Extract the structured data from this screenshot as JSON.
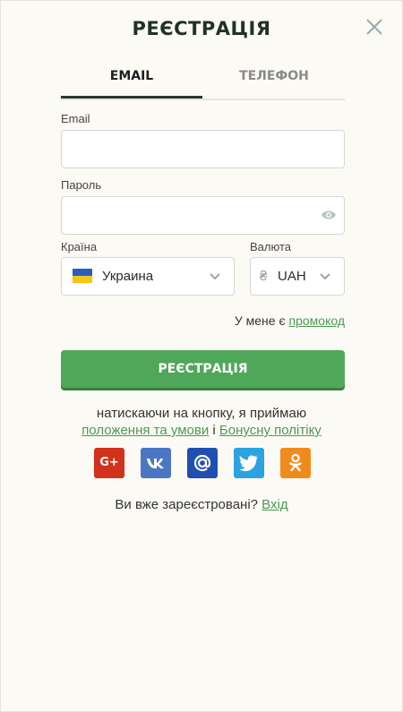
{
  "title": "РЕЄСТРАЦІЯ",
  "close_icon": "close-icon",
  "tabs": [
    {
      "label": "EMAIL",
      "active": true
    },
    {
      "label": "ТЕЛЕФОН",
      "active": false
    }
  ],
  "form": {
    "email": {
      "label": "Email",
      "value": "",
      "placeholder": ""
    },
    "password": {
      "label": "Пароль",
      "value": "",
      "placeholder": "",
      "icon": "eye-icon"
    },
    "country": {
      "label": "Країна",
      "value": "Украина",
      "icon": "ukraine-flag-icon"
    },
    "currency": {
      "label": "Валюта",
      "symbol": "₴",
      "value": "UAH"
    }
  },
  "promo": {
    "text": "У мене є",
    "link": "промокод"
  },
  "submit_label": "РЕЄСТРАЦІЯ",
  "terms": {
    "line1": "натискаючи на кнопку, я приймаю",
    "link1": "положення та умови",
    "conj": "і",
    "link2": "Бонусну політіку"
  },
  "socials": [
    {
      "name": "google-plus",
      "glyph": "G+",
      "color": "#d2311b"
    },
    {
      "name": "vk",
      "glyph": "vk",
      "color": "#4b76c4"
    },
    {
      "name": "mail",
      "glyph": "@",
      "color": "#1f4fb0"
    },
    {
      "name": "twitter",
      "glyph": "twitter",
      "color": "#2aa3e0"
    },
    {
      "name": "odnoklassniki",
      "glyph": "ok",
      "color": "#f08a1d"
    }
  ],
  "login": {
    "text": "Ви вже зареєстровані?",
    "link": "Вхід"
  },
  "colors": {
    "accent": "#4fa85a",
    "link": "#4a9a50",
    "title": "#1f3325"
  }
}
